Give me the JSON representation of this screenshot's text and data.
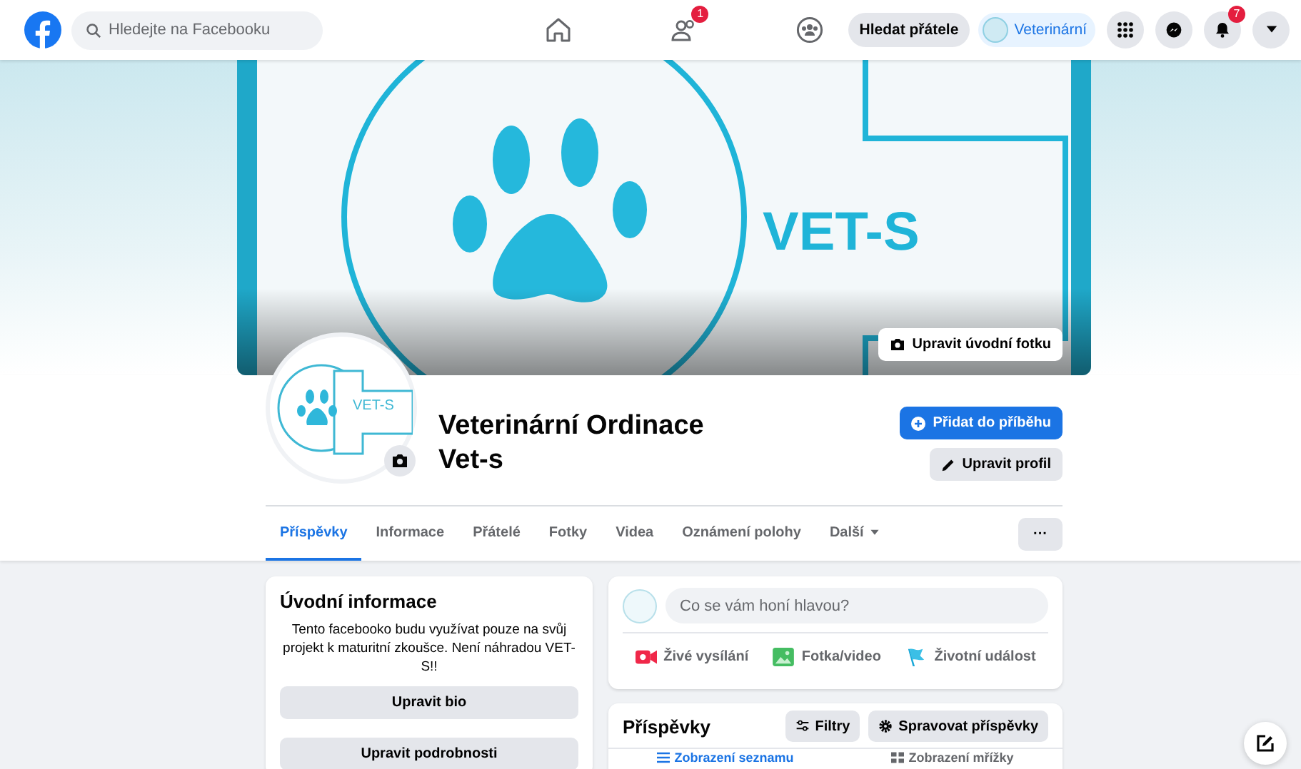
{
  "topbar": {
    "search": {
      "placeholder": "Hledejte na Facebooku"
    },
    "nav": [
      {
        "kind": "home"
      },
      {
        "kind": "friends",
        "badge": "1"
      },
      {
        "kind": "groups"
      }
    ],
    "find_friends": "Hledat přátele",
    "profile_chip": "Veterinární",
    "actions": [
      {
        "kind": "menu"
      },
      {
        "kind": "messenger"
      },
      {
        "kind": "notifications",
        "badge": "7"
      },
      {
        "kind": "account"
      }
    ]
  },
  "cover": {
    "logo_text": "VET-S",
    "edit_button": "Upravit úvodní fotku"
  },
  "profile": {
    "avatar_text": "VET-S",
    "name_line_1": "Veterinární Ordinace",
    "name_line_2": "Vet-s",
    "add_story": "Přidat do příběhu",
    "edit_profile": "Upravit profil"
  },
  "tabs": [
    {
      "label": "Příspěvky",
      "selected": true,
      "kind": "plain"
    },
    {
      "label": "Informace",
      "selected": false,
      "kind": "plain"
    },
    {
      "label": "Přátelé",
      "selected": false,
      "kind": "plain"
    },
    {
      "label": "Fotky",
      "selected": false,
      "kind": "plain"
    },
    {
      "label": "Videa",
      "selected": false,
      "kind": "plain"
    },
    {
      "label": "Oznámení polohy",
      "selected": false,
      "kind": "plain"
    },
    {
      "label": "Další",
      "selected": false,
      "kind": "dropdown"
    }
  ],
  "more_button": "···",
  "intro": {
    "title": "Úvodní informace",
    "bio": "Tento facebooko budu využívat pouze na svůj projekt k maturitní zkoušce. Není náhradou VET-S!!",
    "buttons": [
      "Upravit bio",
      "Upravit podrobnosti"
    ]
  },
  "composer": {
    "placeholder": "Co se vám honí hlavou?",
    "actions": [
      {
        "kind": "live",
        "label": "Živé vysílání"
      },
      {
        "kind": "photo",
        "label": "Fotka/video"
      },
      {
        "kind": "event",
        "label": "Životní událost"
      }
    ]
  },
  "posts": {
    "title": "Příspěvky",
    "filters": "Filtry",
    "manage": "Spravovat příspěvky",
    "views": [
      {
        "label": "Zobrazení seznamu",
        "selected": true
      },
      {
        "label": "Zobrazení mřížky",
        "selected": false
      }
    ]
  }
}
